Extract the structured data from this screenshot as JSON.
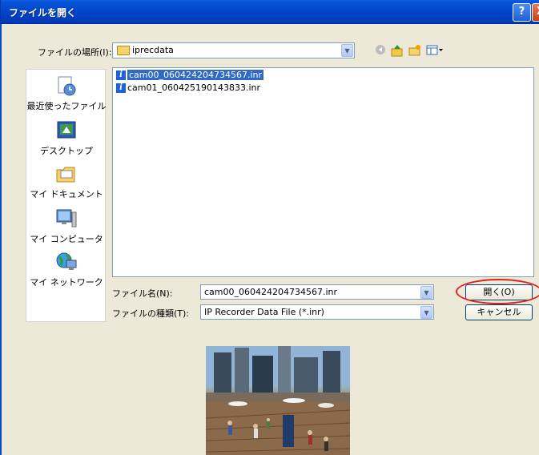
{
  "titlebar": {
    "title": "ファイルを開く",
    "help": "?",
    "close": "X"
  },
  "lookin": {
    "label": "ファイルの場所(I):",
    "value": "iprecdata"
  },
  "toolbar": {
    "back_icon": "back-icon",
    "up_icon": "up-folder-icon",
    "newfolder_icon": "new-folder-icon",
    "view_icon": "view-menu-icon"
  },
  "places": [
    {
      "label": "最近使ったファイル",
      "icon": "recent-icon"
    },
    {
      "label": "デスクトップ",
      "icon": "desktop-icon"
    },
    {
      "label": "マイ ドキュメント",
      "icon": "documents-icon"
    },
    {
      "label": "マイ コンピュータ",
      "icon": "computer-icon"
    },
    {
      "label": "マイ ネットワーク",
      "icon": "network-icon"
    }
  ],
  "files": [
    {
      "name": "cam00_060424204734567.inr",
      "selected": true
    },
    {
      "name": "cam01_060425190143833.inr",
      "selected": false
    }
  ],
  "filename": {
    "label": "ファイル名(N):",
    "value": "cam00_060424204734567.inr"
  },
  "filetype": {
    "label": "ファイルの種類(T):",
    "value": "IP Recorder Data File (*.inr)"
  },
  "buttons": {
    "open": "開く(O)",
    "cancel": "キャンセル"
  },
  "colors": {
    "title_bar": "#0044c9",
    "selection": "#316ac5",
    "highlight_ring": "#e02020"
  }
}
